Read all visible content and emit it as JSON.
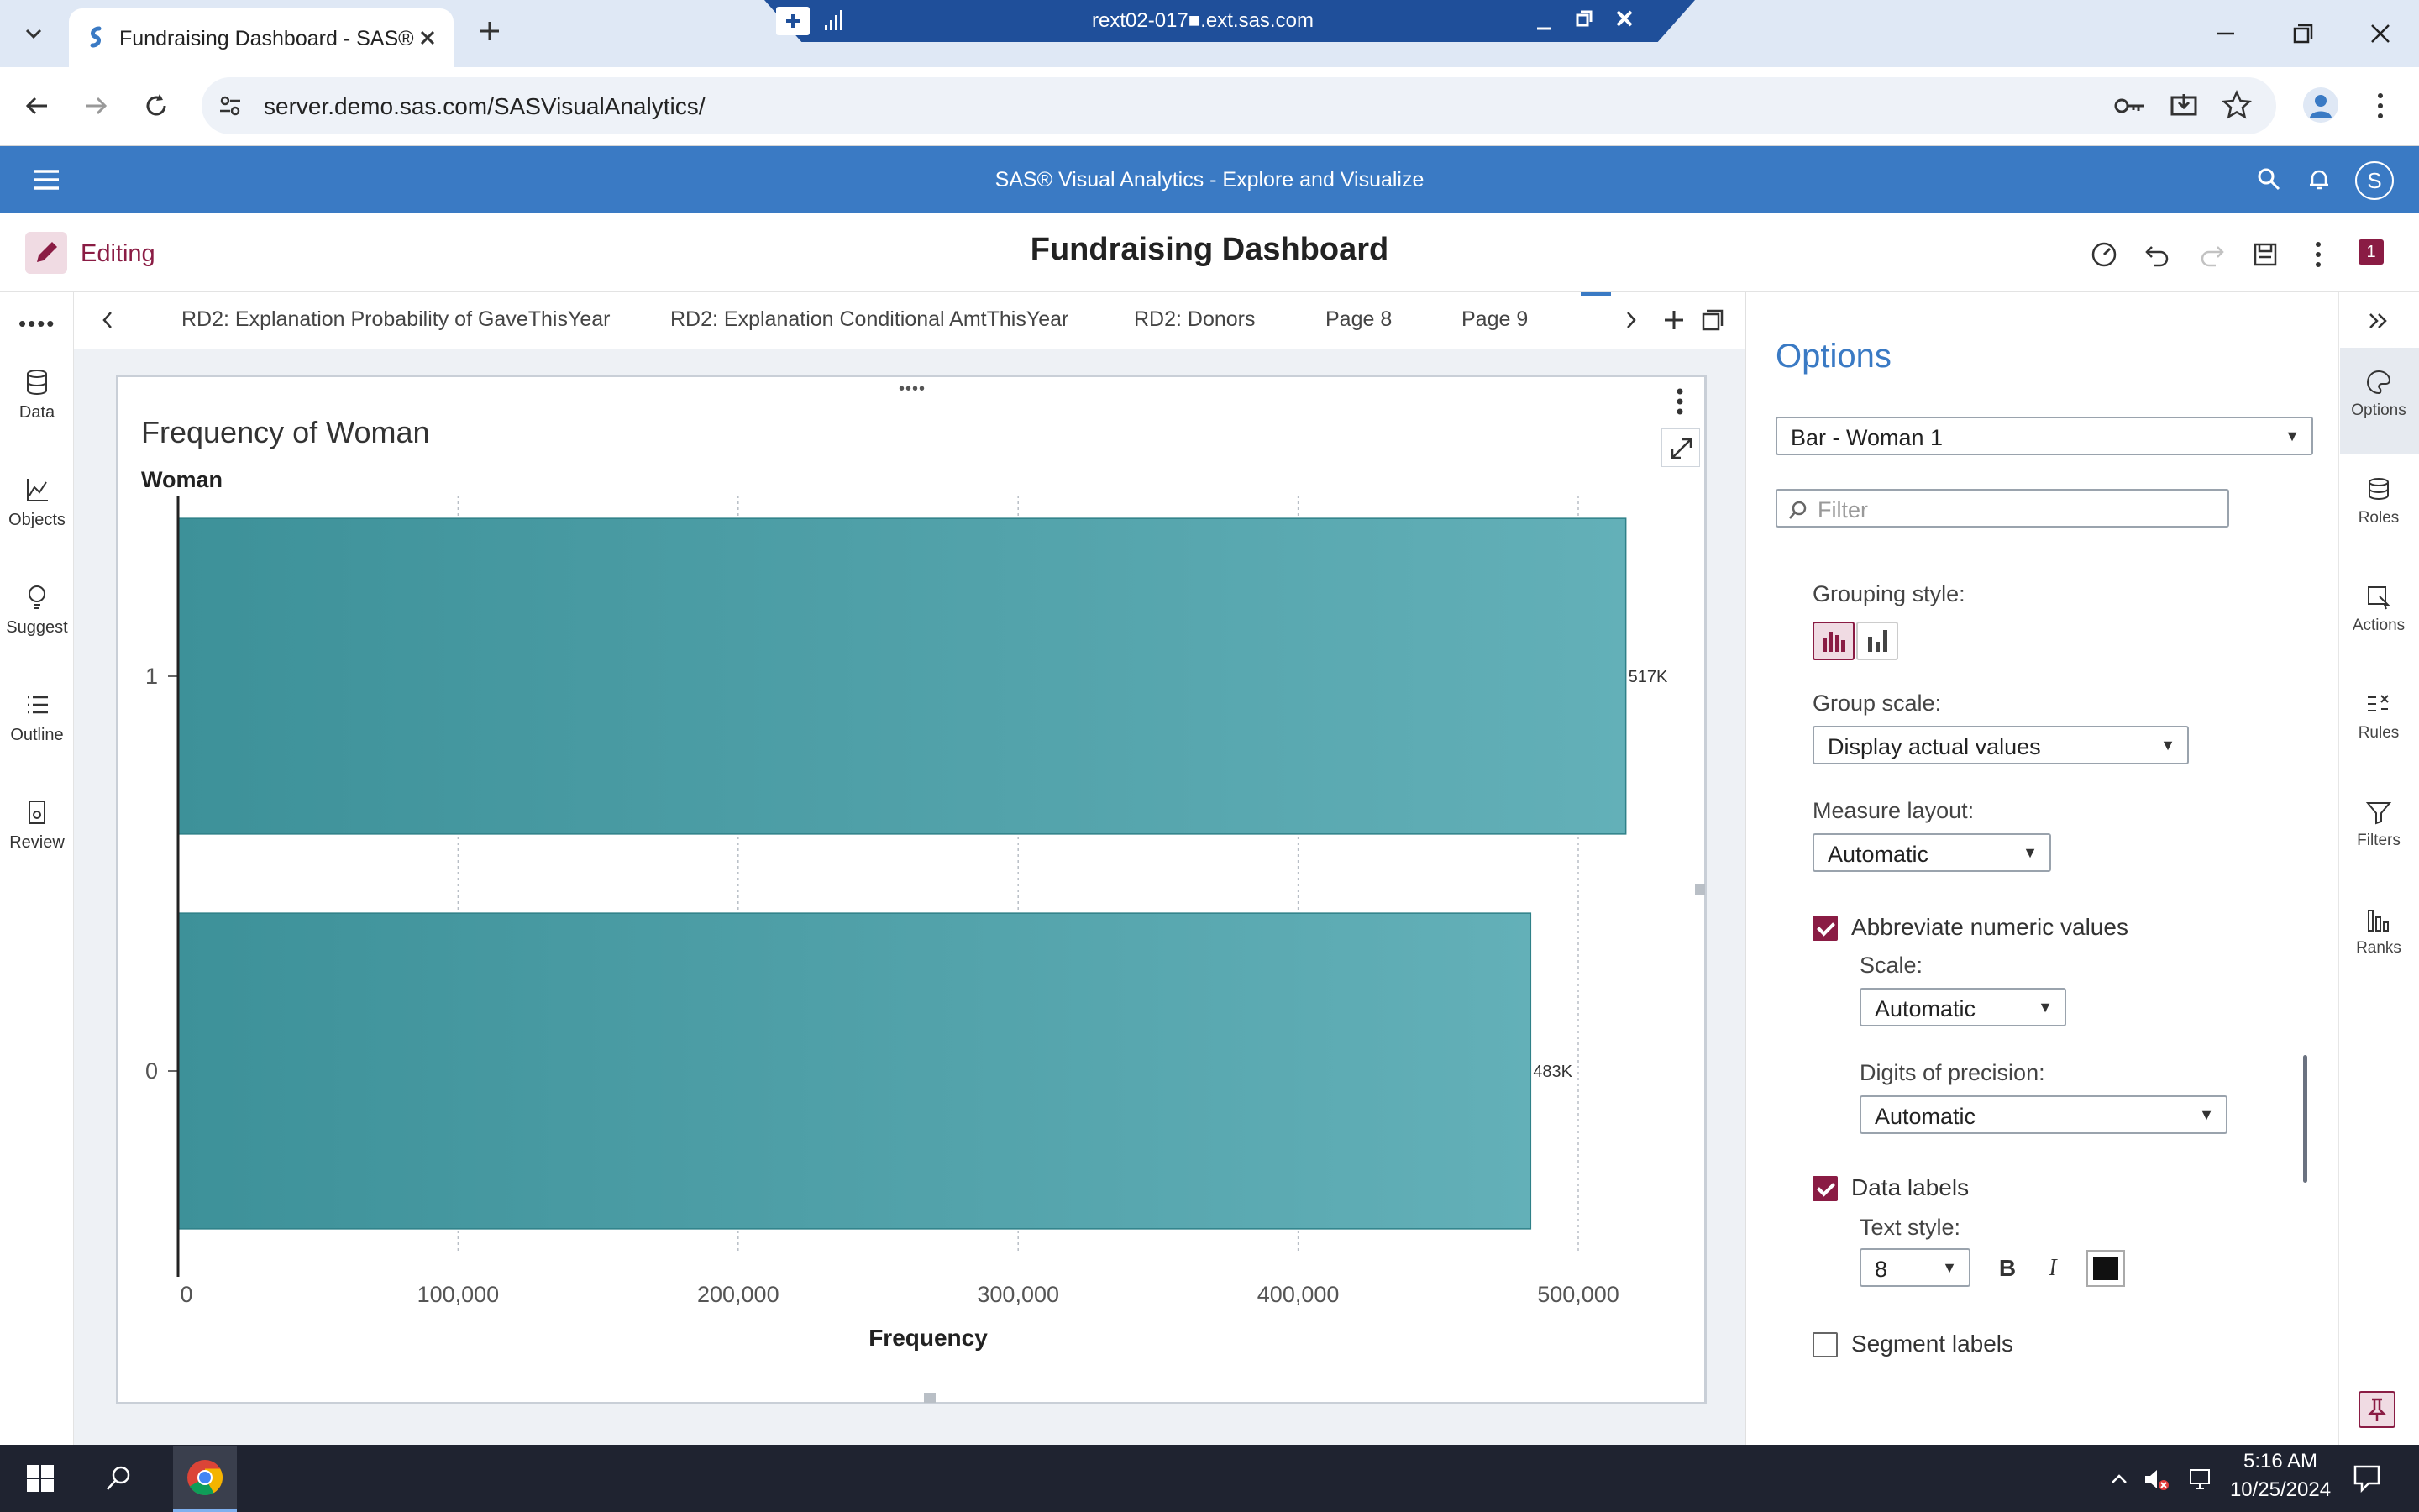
{
  "browser": {
    "tab_title": "Fundraising Dashboard - SAS®",
    "url": "server.demo.sas.com/SASVisualAnalytics/",
    "remote_title": "rext02-017■.ext.sas.com"
  },
  "app": {
    "title": "SAS® Visual Analytics - Explore and Visualize",
    "user_initial": "S",
    "mode_label": "Editing",
    "report_title": "Fundraising Dashboard",
    "badge": "1"
  },
  "left_rail": [
    {
      "label": "Data",
      "icon": "database-icon"
    },
    {
      "label": "Objects",
      "icon": "line-chart-icon"
    },
    {
      "label": "Suggest",
      "icon": "lightbulb-icon"
    },
    {
      "label": "Outline",
      "icon": "list-icon"
    },
    {
      "label": "Review",
      "icon": "review-icon"
    }
  ],
  "page_tabs": [
    "RD2: Explanation Probability of GaveThisYear",
    "RD2: Explanation Conditional AmtThisYear",
    "RD2: Donors",
    "Page 8",
    "Page 9"
  ],
  "chart_data": {
    "type": "bar",
    "orientation": "horizontal",
    "title": "Frequency of Woman",
    "ylabel": "Woman",
    "xlabel": "Frequency",
    "categories": [
      "1",
      "0"
    ],
    "values": [
      517000,
      483000
    ],
    "data_labels": [
      "517K",
      "483K"
    ],
    "xlim": [
      0,
      520000
    ],
    "x_ticks": [
      0,
      100000,
      200000,
      300000,
      400000,
      500000
    ],
    "x_tick_labels": [
      "0",
      "100,000",
      "200,000",
      "300,000",
      "400,000",
      "500,000"
    ],
    "grid": "vertical dotted",
    "bar_color": "#4ea3ab"
  },
  "options": {
    "title": "Options",
    "object_select": "Bar - Woman 1",
    "filter_placeholder": "Filter",
    "grouping_style_label": "Grouping style:",
    "group_scale_label": "Group scale:",
    "group_scale_value": "Display actual values",
    "measure_layout_label": "Measure layout:",
    "measure_layout_value": "Automatic",
    "abbreviate_label": "Abbreviate numeric values",
    "abbreviate_checked": true,
    "scale_label": "Scale:",
    "scale_value": "Automatic",
    "digits_label": "Digits of precision:",
    "digits_value": "Automatic",
    "data_labels_label": "Data labels",
    "data_labels_checked": true,
    "text_style_label": "Text style:",
    "font_size_value": "8",
    "bold_label": "B",
    "italic_label": "I",
    "segment_labels_label": "Segment labels",
    "segment_labels_checked": false
  },
  "right_rail": [
    {
      "label": "Options",
      "icon": "palette-icon"
    },
    {
      "label": "Roles",
      "icon": "roles-icon"
    },
    {
      "label": "Actions",
      "icon": "actions-icon"
    },
    {
      "label": "Rules",
      "icon": "rules-icon"
    },
    {
      "label": "Filters",
      "icon": "filter-icon"
    },
    {
      "label": "Ranks",
      "icon": "ranks-icon"
    }
  ],
  "taskbar": {
    "time": "5:16 AM",
    "date": "10/25/2024"
  },
  "colors": {
    "sas_blue": "#3a7ac4",
    "accent": "#8a1c44",
    "bar": "#4ea3ab"
  }
}
